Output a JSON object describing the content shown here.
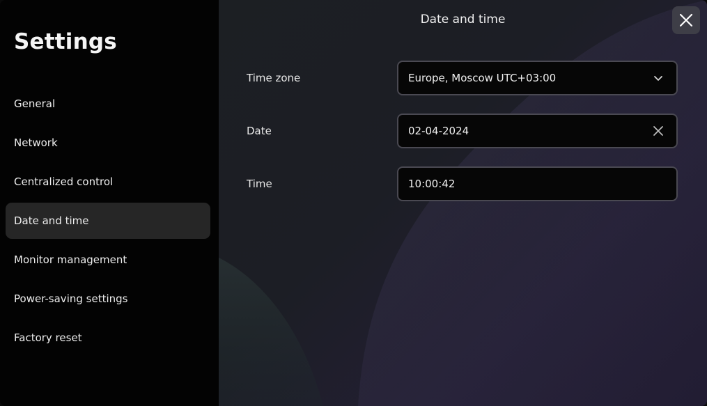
{
  "sidebar": {
    "title": "Settings",
    "items": [
      {
        "label": "General"
      },
      {
        "label": "Network"
      },
      {
        "label": "Centralized control"
      },
      {
        "label": "Date and time",
        "active": true
      },
      {
        "label": "Monitor management"
      },
      {
        "label": "Power-saving settings"
      },
      {
        "label": "Factory reset"
      }
    ]
  },
  "header": {
    "title": "Date and time",
    "close_icon": "close-icon"
  },
  "form": {
    "timezone": {
      "label": "Time zone",
      "value": "Europe, Moscow UTC+03:00",
      "icon": "chevron-down-icon"
    },
    "date": {
      "label": "Date",
      "value": "02-04-2024",
      "icon": "clear-icon"
    },
    "time": {
      "label": "Time",
      "value": "10:00:42"
    }
  },
  "colors": {
    "sidebar_bg": "#030303",
    "active_item_bg": "#262626",
    "field_border": "#4a4952",
    "close_bg": "#3e3e47"
  }
}
